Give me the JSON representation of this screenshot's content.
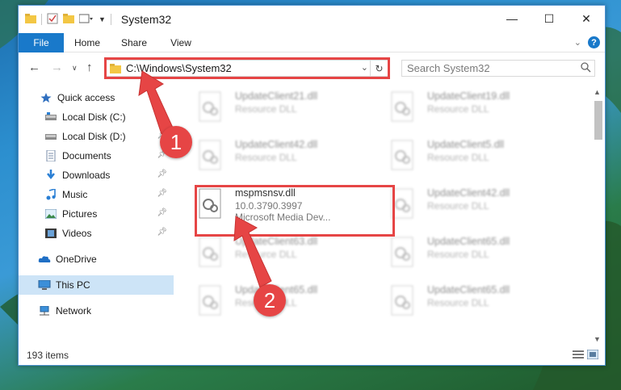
{
  "window": {
    "title": "System32",
    "controls": {
      "minimize": "—",
      "maximize": "☐",
      "close": "✕"
    }
  },
  "ribbon": {
    "file_tab": "File",
    "tabs": [
      "Home",
      "Share",
      "View"
    ],
    "expand_icon": "chevron-down-icon",
    "help_label": "?"
  },
  "address_bar": {
    "path": "C:\\Windows\\System32",
    "search_placeholder": "Search System32"
  },
  "sidebar": {
    "items": [
      {
        "label": "Quick access",
        "icon": "star-icon",
        "pinned": false
      },
      {
        "label": "Local Disk (C:)",
        "icon": "drive-icon",
        "pinned": true
      },
      {
        "label": "Local Disk (D:)",
        "icon": "drive-icon",
        "pinned": true
      },
      {
        "label": "Documents",
        "icon": "documents-icon",
        "pinned": true
      },
      {
        "label": "Downloads",
        "icon": "downloads-icon",
        "pinned": true
      },
      {
        "label": "Music",
        "icon": "music-icon",
        "pinned": true
      },
      {
        "label": "Pictures",
        "icon": "pictures-icon",
        "pinned": true
      },
      {
        "label": "Videos",
        "icon": "videos-icon",
        "pinned": true
      },
      {
        "label": "OneDrive",
        "icon": "cloud-icon",
        "pinned": false
      },
      {
        "label": "This PC",
        "icon": "computer-icon",
        "pinned": false,
        "selected": true
      },
      {
        "label": "Network",
        "icon": "network-icon",
        "pinned": false
      }
    ]
  },
  "files": [
    {
      "name": "UpdateClient21.dll",
      "type": "Resource DLL"
    },
    {
      "name": "UpdateClient19.dll",
      "type": "Resource DLL"
    },
    {
      "name": "UpdateClient42.dll",
      "type": "Resource DLL"
    },
    {
      "name": "UpdateClient5.dll",
      "type": "Resource DLL"
    },
    {
      "name": "mspmsnsv.dll",
      "version": "10.0.3790.3997",
      "description": "Microsoft Media Dev...",
      "highlighted": true
    },
    {
      "name": "UpdateClient42.dll",
      "type": "Resource DLL"
    },
    {
      "name": "UpdateClient63.dll",
      "type": "Resource DLL"
    },
    {
      "name": "UpdateClient65.dll",
      "type": "Resource DLL"
    },
    {
      "name": "UpdateClient65.dll",
      "type": "Resource DLL"
    },
    {
      "name": "UpdateClient65.dll",
      "type": "Resource DLL"
    }
  ],
  "status": {
    "item_count": "193 items"
  },
  "annotations": {
    "step1": "1",
    "step2": "2",
    "color": "#e64545"
  },
  "colors": {
    "accent": "#1979ca",
    "highlight": "#e64545",
    "selected": "#cde4f7"
  }
}
